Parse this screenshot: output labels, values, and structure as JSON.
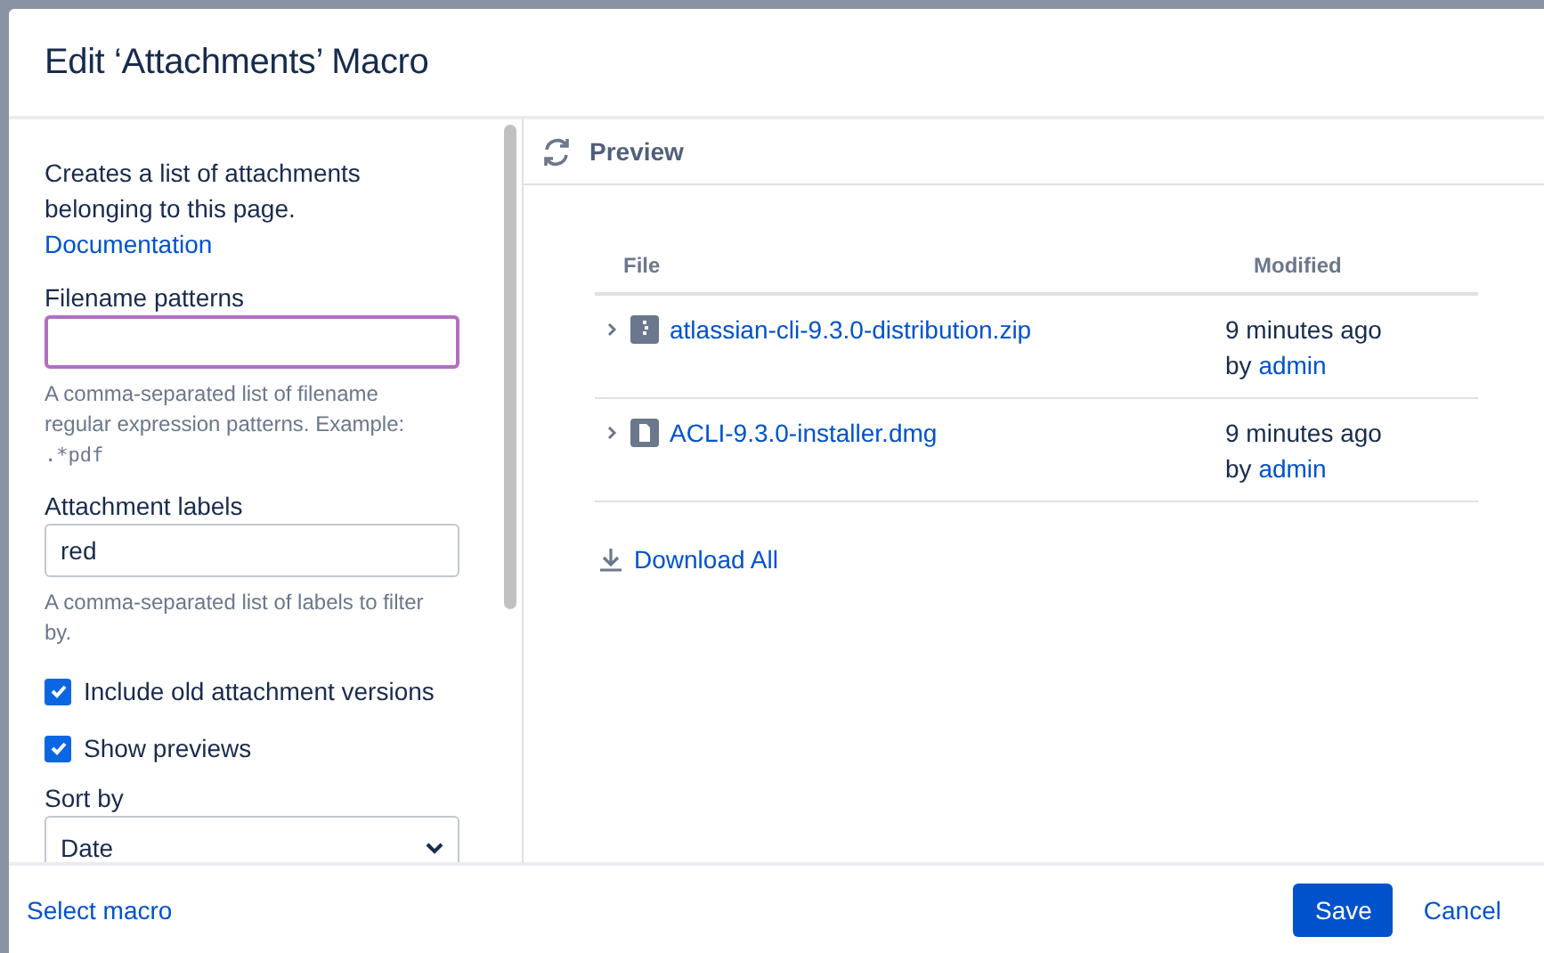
{
  "dialog": {
    "title": "Edit ‘Attachments’ Macro"
  },
  "sidebar": {
    "description": "Creates a list of attachments belonging to this page.",
    "documentation_link": "Documentation",
    "fields": [
      {
        "kind": "text",
        "label": "Filename patterns",
        "focused": true,
        "help": "A comma-separated list of filename regular expression patterns. Example:",
        "help_code": ".*pdf"
      },
      {
        "kind": "text",
        "label": "Attachment labels",
        "value": "red",
        "focused": false,
        "help": "A comma-separated list of labels to filter by."
      },
      {
        "kind": "checkbox",
        "label": "Include old attachment versions",
        "checked": true
      },
      {
        "kind": "checkbox",
        "label": "Show previews",
        "checked": true
      },
      {
        "kind": "select",
        "label": "Sort by",
        "value": "Date"
      }
    ]
  },
  "preview": {
    "title": "Preview",
    "table": {
      "columns": [
        "File",
        "Modified"
      ],
      "rows": [
        {
          "file": "atlassian-cli-9.3.0-distribution.zip",
          "kind": "archive",
          "expanded": false,
          "modified": "9 minutes ago",
          "by": "by",
          "author": "admin"
        },
        {
          "file": "ACLI-9.3.0-installer.dmg",
          "kind": "document",
          "expanded": false,
          "modified": "9 minutes ago",
          "by": "by",
          "author": "admin"
        }
      ]
    },
    "download_all": "Download All"
  },
  "footer": {
    "select_macro": "Select macro",
    "buttons": [
      {
        "label": "Save",
        "primary": true
      },
      {
        "label": "Cancel",
        "primary": false
      }
    ]
  }
}
